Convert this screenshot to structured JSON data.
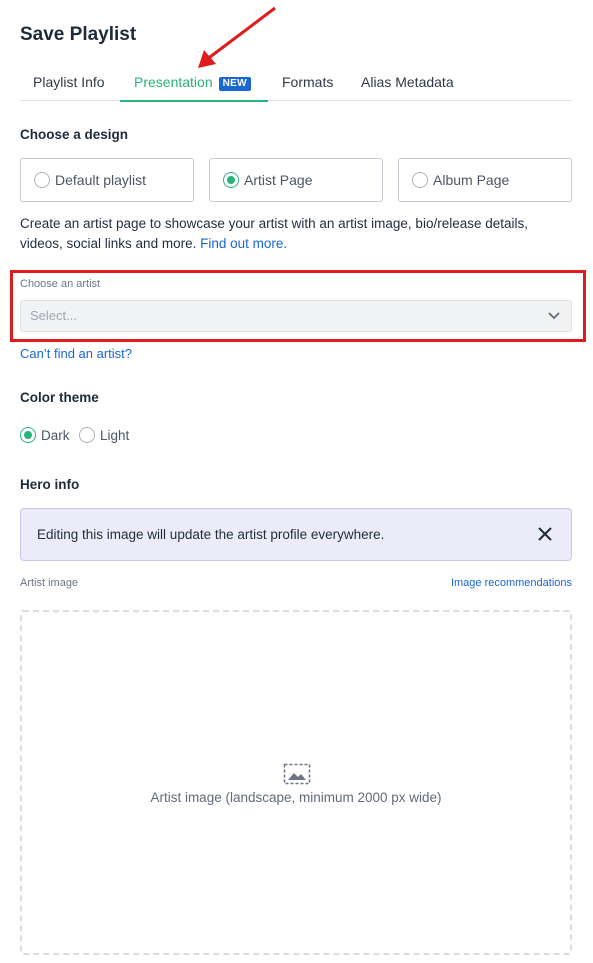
{
  "page": {
    "title": "Save Playlist"
  },
  "tabs": [
    {
      "label": "Playlist Info"
    },
    {
      "label": "Presentation",
      "badge": "NEW",
      "active": true
    },
    {
      "label": "Formats"
    },
    {
      "label": "Alias Metadata"
    }
  ],
  "design": {
    "heading": "Choose a design",
    "options": [
      {
        "label": "Default playlist",
        "selected": false
      },
      {
        "label": "Artist Page",
        "selected": true
      },
      {
        "label": "Album Page",
        "selected": false
      }
    ],
    "description": "Create an artist page to showcase your artist with an artist image, bio/release details, videos, social links and more.",
    "find_out_more": "Find out more."
  },
  "artist": {
    "label": "Choose an artist",
    "placeholder": "Select...",
    "cant_find": "Can’t find an artist?"
  },
  "theme": {
    "heading": "Color theme",
    "options": [
      {
        "label": "Dark",
        "selected": true
      },
      {
        "label": "Light",
        "selected": false
      }
    ]
  },
  "hero": {
    "heading": "Hero info",
    "notice": "Editing this image will update the artist profile everywhere.",
    "image_label": "Artist image",
    "image_recommendations": "Image recommendations",
    "dropzone_text": "Artist image (landscape, minimum 2000 px wide)"
  },
  "colors": {
    "accent_green": "#2ab27b",
    "link_blue": "#1967d2",
    "annotation_red": "#e01b1b",
    "notice_bg": "#ecebfa"
  }
}
